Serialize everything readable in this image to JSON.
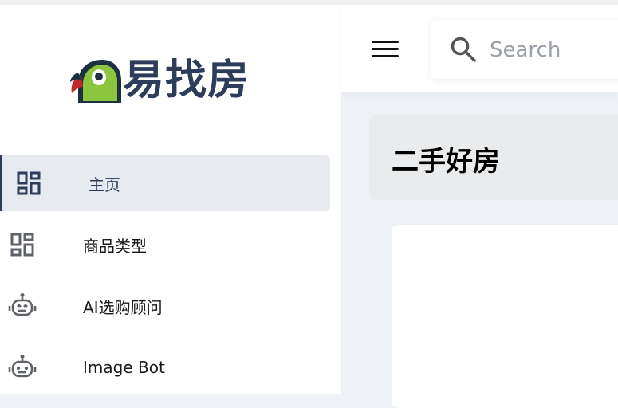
{
  "brand": {
    "name": "易找房"
  },
  "sidebar": {
    "items": [
      {
        "label": "主页",
        "icon": "dashboard-icon",
        "active": true
      },
      {
        "label": "商品类型",
        "icon": "dashboard-icon",
        "active": false
      },
      {
        "label": "AI选购顾问",
        "icon": "robot-icon",
        "active": false
      },
      {
        "label": "Image Bot",
        "icon": "robot-icon",
        "active": false
      }
    ]
  },
  "header": {
    "search": {
      "placeholder": "Search",
      "value": ""
    }
  },
  "main": {
    "title": "二手好房"
  },
  "colors": {
    "brand_dark": "#2d3c5a",
    "active_bg": "#e6e9ed",
    "page_bg": "#eef1f5",
    "parrot_green": "#8cc63f",
    "parrot_red": "#c1272d"
  }
}
